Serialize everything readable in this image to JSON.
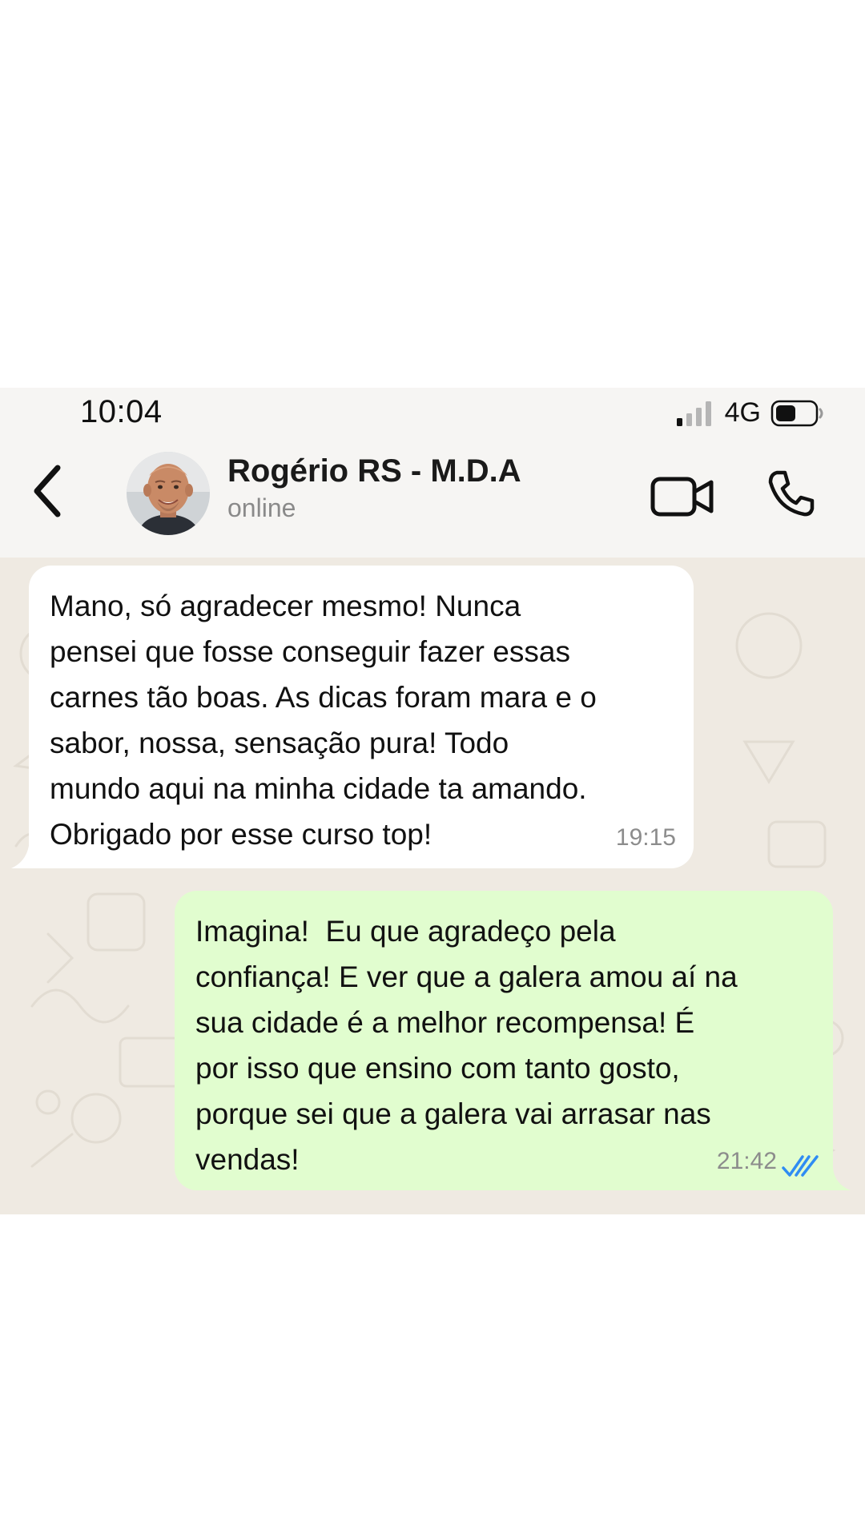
{
  "status_bar": {
    "time": "10:04",
    "network": "4G"
  },
  "header": {
    "contact_name": "Rogério RS - M.D.A",
    "contact_status": "online"
  },
  "messages": [
    {
      "direction": "incoming",
      "lines": [
        "Mano, só agradecer mesmo! Nunca",
        "pensei que fosse conseguir fazer essas",
        "carnes tão boas. As dicas foram mara e o",
        "sabor, nossa, sensação pura! Todo",
        "mundo aqui na minha cidade ta amando.",
        "Obrigado por esse curso top!"
      ],
      "time": "19:15"
    },
    {
      "direction": "outgoing",
      "lines": [
        "Imagina!  Eu que agradeço pela",
        "confiança! E ver que a galera amou aí na",
        "sua cidade é a melhor recompensa! É",
        "por isso que ensino com tanto gosto,",
        "porque sei que a galera vai arrasar nas",
        "vendas!"
      ],
      "time": "21:42",
      "status": "read"
    }
  ],
  "colors": {
    "incoming_bubble": "#ffffff",
    "outgoing_bubble": "#e1fdcf",
    "read_ticks": "#2f8cf3",
    "header_background": "#f6f5f3",
    "chat_background": "#efeae2"
  },
  "icons": {
    "back": "chevron-left-icon",
    "video_call": "video-camera-icon",
    "voice_call": "phone-icon",
    "signal": "signal-bars-icon",
    "battery": "battery-icon",
    "read_receipt": "double-check-icon"
  }
}
